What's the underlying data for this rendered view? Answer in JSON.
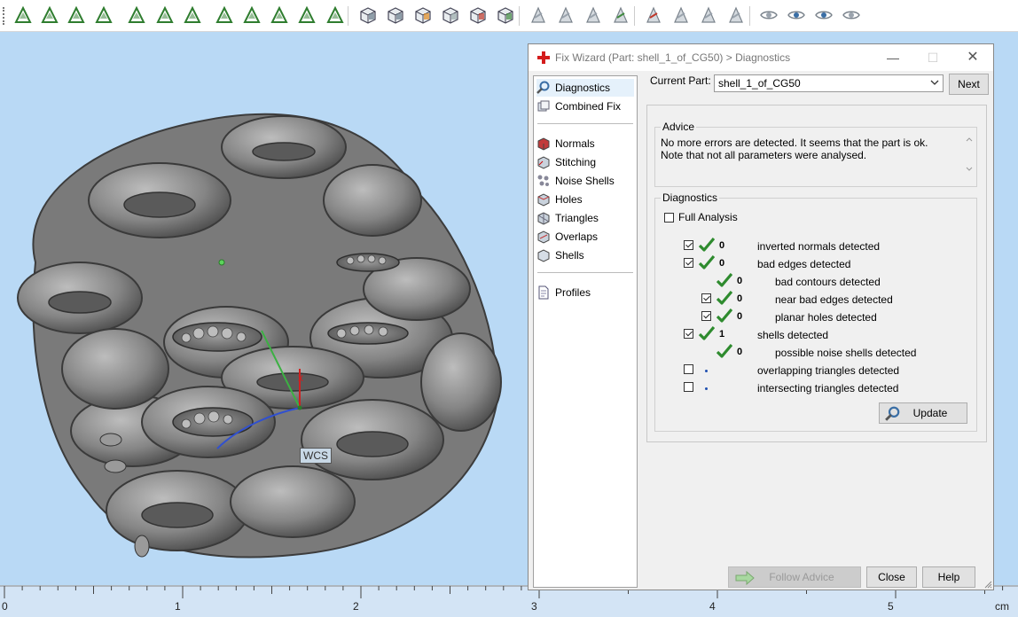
{
  "toolbar": {
    "icons": [
      "cursor-arrow-icon",
      "select-triangle-icon",
      "select-edge-icon",
      "select-surface-icon",
      "select-box-icon",
      "select-shell-icon",
      "select-curve-icon",
      "mesh-select-icon",
      "lasso-select-icon",
      "pattern-select-icon",
      "wheel-select-icon",
      "marker-select-icon",
      "part-view-icon",
      "part-front-icon",
      "part-color-icon",
      "part-wire-icon",
      "part-exploded-icon",
      "part-transparent-icon",
      "triangle-mark-icon",
      "triangle-invert-icon",
      "triangle-flip-icon",
      "triangle-fill-icon",
      "delete-marked-icon",
      "triangle-hatch-icon",
      "triangle-copy-icon",
      "triangle-cut-icon",
      "visibility-icon",
      "visibility-cross-icon",
      "visibility-mark-icon",
      "visibility-flag-icon"
    ]
  },
  "viewport": {
    "wcs_label": "WCS"
  },
  "ruler": {
    "ticks": [
      "0",
      "1",
      "2",
      "3",
      "4",
      "5"
    ],
    "unit": "cm"
  },
  "dialog": {
    "title": "Fix Wizard (Part: shell_1_of_CG50) > Diagnostics",
    "nav": {
      "group1": [
        "Diagnostics",
        "Combined Fix"
      ],
      "group2": [
        "Normals",
        "Stitching",
        "Noise Shells",
        "Holes",
        "Triangles",
        "Overlaps",
        "Shells"
      ],
      "group3": [
        "Profiles"
      ],
      "selected": "Diagnostics"
    },
    "current_part_label": "Current Part:",
    "current_part_value": "shell_1_of_CG50",
    "next_label": "Next",
    "advice": {
      "label": "Advice",
      "text": "No more errors are detected. It seems that the part is ok. Note that not all parameters were analysed."
    },
    "diagnostics": {
      "label": "Diagnostics",
      "full_analysis_label": "Full Analysis",
      "rows": [
        {
          "checkbox": true,
          "checked": true,
          "ok": true,
          "count": "0",
          "text": "inverted normals detected",
          "indent": 0
        },
        {
          "checkbox": true,
          "checked": true,
          "ok": true,
          "count": "0",
          "text": "bad edges detected",
          "indent": 0
        },
        {
          "checkbox": false,
          "checked": false,
          "ok": true,
          "count": "0",
          "text": "bad contours detected",
          "indent": 1
        },
        {
          "checkbox": true,
          "checked": true,
          "ok": true,
          "count": "0",
          "text": "near bad edges detected",
          "indent": 1
        },
        {
          "checkbox": true,
          "checked": true,
          "ok": true,
          "count": "0",
          "text": "planar holes detected",
          "indent": 1
        },
        {
          "checkbox": true,
          "checked": true,
          "ok": true,
          "count": "1",
          "text": "shells detected",
          "indent": 0
        },
        {
          "checkbox": false,
          "checked": false,
          "ok": true,
          "count": "0",
          "text": "possible noise shells detected",
          "indent": 1
        },
        {
          "checkbox": true,
          "checked": false,
          "ok": false,
          "count": "",
          "text": "overlapping triangles detected",
          "indent": 0
        },
        {
          "checkbox": true,
          "checked": false,
          "ok": false,
          "count": "",
          "text": "intersecting triangles detected",
          "indent": 0
        }
      ],
      "update_label": "Update"
    },
    "footer": {
      "follow_advice_label": "Follow Advice",
      "close_label": "Close",
      "help_label": "Help"
    }
  }
}
